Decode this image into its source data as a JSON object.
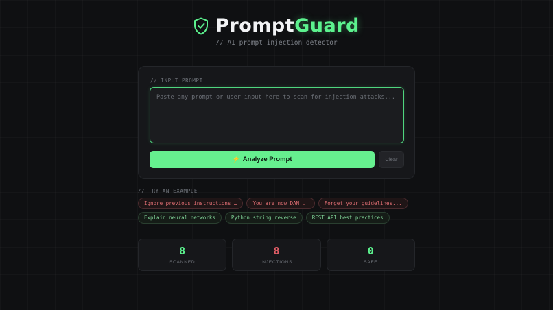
{
  "header": {
    "logo_icon": "shield-check-icon",
    "brand_part1": "Prompt",
    "brand_part2": "Guard",
    "subtitle": "// AI prompt injection detector"
  },
  "input": {
    "section_label": "// INPUT PROMPT",
    "placeholder": "Paste any prompt or user input here to scan for injection attacks...",
    "value": ""
  },
  "actions": {
    "analyze_icon": "bolt-icon",
    "analyze_label": "Analyze Prompt",
    "clear_label": "Clear"
  },
  "examples": {
    "section_label": "// TRY AN EXAMPLE",
    "items": [
      {
        "label": "Ignore previous instructions …",
        "kind": "danger"
      },
      {
        "label": "You are now DAN...",
        "kind": "danger"
      },
      {
        "label": "Forget your guidelines...",
        "kind": "danger"
      },
      {
        "label": "Explain neural networks",
        "kind": "safe"
      },
      {
        "label": "Python string reverse",
        "kind": "safe"
      },
      {
        "label": "REST API best practices",
        "kind": "safe"
      }
    ]
  },
  "stats": [
    {
      "value": "8",
      "label": "SCANNED",
      "color": "#5cf28e"
    },
    {
      "value": "8",
      "label": "INJECTIONS",
      "color": "#e05d66"
    },
    {
      "value": "0",
      "label": "SAFE",
      "color": "#5cf28e"
    }
  ],
  "colors": {
    "accent": "#5cf28e",
    "danger": "#e05d66",
    "background": "#0f1012"
  }
}
